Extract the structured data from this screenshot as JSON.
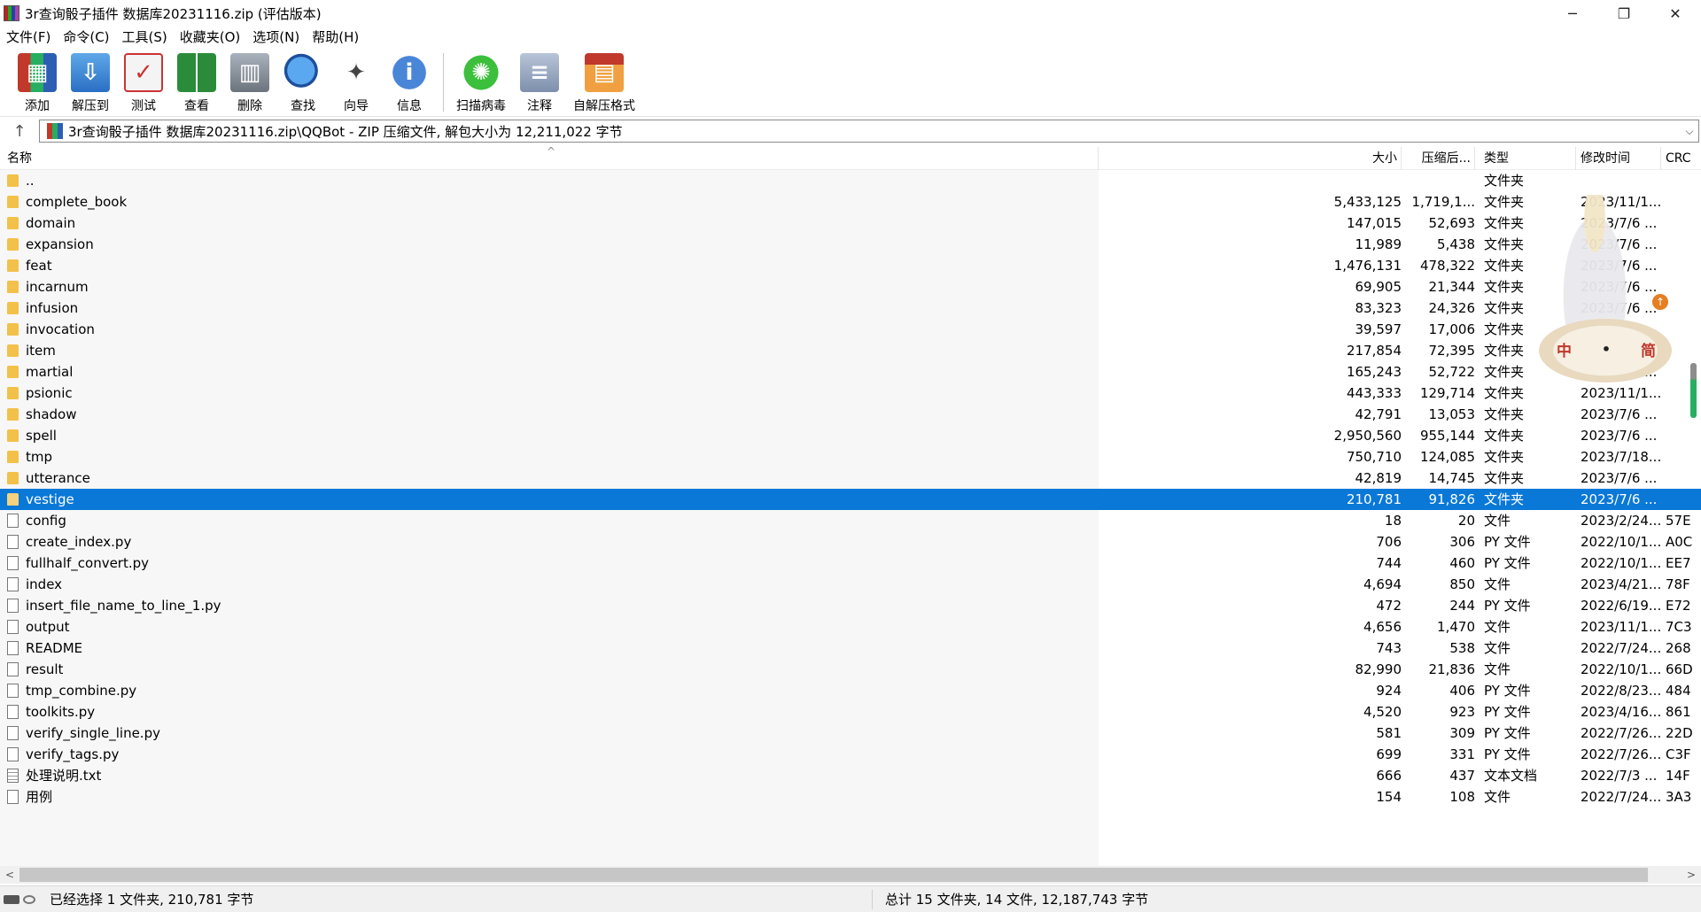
{
  "window": {
    "title": "3r查询骰子插件 数据库20231116.zip (评估版本)",
    "controls": {
      "minimize": "─",
      "maximize": "❐",
      "close": "✕"
    }
  },
  "menu": [
    "文件(F)",
    "命令(C)",
    "工具(S)",
    "收藏夹(O)",
    "选项(N)",
    "帮助(H)"
  ],
  "toolbar": [
    {
      "label": "添加",
      "icon": "add-archive-icon",
      "cls": "ic-add",
      "glyph": "▦"
    },
    {
      "label": "解压到",
      "icon": "extract-folder-icon",
      "cls": "ic-extract",
      "glyph": "⇩"
    },
    {
      "label": "测试",
      "icon": "test-clipboard-icon",
      "cls": "ic-test",
      "glyph": "✓"
    },
    {
      "label": "查看",
      "icon": "view-book-icon",
      "cls": "ic-view",
      "glyph": ""
    },
    {
      "label": "删除",
      "icon": "delete-trash-icon",
      "cls": "ic-delete",
      "glyph": "▥"
    },
    {
      "label": "查找",
      "icon": "find-magnifier-icon",
      "cls": "ic-find",
      "glyph": ""
    },
    {
      "label": "向导",
      "icon": "wizard-wand-icon",
      "cls": "ic-wizard",
      "glyph": "✦"
    },
    {
      "label": "信息",
      "icon": "info-icon",
      "cls": "ic-info",
      "glyph": "i"
    },
    {
      "separator": true
    },
    {
      "label": "扫描病毒",
      "icon": "scan-virus-icon",
      "cls": "ic-virus",
      "glyph": "✺"
    },
    {
      "label": "注释",
      "icon": "comment-icon",
      "cls": "ic-comment",
      "glyph": "≡"
    },
    {
      "label": "自解压格式",
      "icon": "sfx-box-icon",
      "cls": "ic-sfx",
      "glyph": "▤"
    }
  ],
  "address": {
    "up_icon": "↑",
    "path": "3r查询骰子插件 数据库20231116.zip\\QQBot - ZIP 压缩文件, 解包大小为 12,211,022 字节",
    "dropdown": "⌵"
  },
  "columns": {
    "name": "名称",
    "size": "大小",
    "packed": "压缩后...",
    "type": "类型",
    "modified": "修改时间",
    "crc": "CRC",
    "sort_arrow": "^"
  },
  "files": [
    {
      "name": "..",
      "size": "",
      "packed": "",
      "type": "文件夹",
      "modified": "",
      "crc": "",
      "kind": "folder"
    },
    {
      "name": "complete_book",
      "size": "5,433,125",
      "packed": "1,719,1...",
      "type": "文件夹",
      "modified": "2023/11/1...",
      "crc": "",
      "kind": "folder"
    },
    {
      "name": "domain",
      "size": "147,015",
      "packed": "52,693",
      "type": "文件夹",
      "modified": "2023/7/6 ...",
      "crc": "",
      "kind": "folder"
    },
    {
      "name": "expansion",
      "size": "11,989",
      "packed": "5,438",
      "type": "文件夹",
      "modified": "2023/7/6 ...",
      "crc": "",
      "kind": "folder"
    },
    {
      "name": "feat",
      "size": "1,476,131",
      "packed": "478,322",
      "type": "文件夹",
      "modified": "2023/7/6 ...",
      "crc": "",
      "kind": "folder"
    },
    {
      "name": "incarnum",
      "size": "69,905",
      "packed": "21,344",
      "type": "文件夹",
      "modified": "2023/7/6 ...",
      "crc": "",
      "kind": "folder"
    },
    {
      "name": "infusion",
      "size": "83,323",
      "packed": "24,326",
      "type": "文件夹",
      "modified": "2023/7/6 ...",
      "crc": "",
      "kind": "folder"
    },
    {
      "name": "invocation",
      "size": "39,597",
      "packed": "17,006",
      "type": "文件夹",
      "modified": "2023/7/6 ...",
      "crc": "",
      "kind": "folder"
    },
    {
      "name": "item",
      "size": "217,854",
      "packed": "72,395",
      "type": "文件夹",
      "modified": "2023/7/6 ...",
      "crc": "",
      "kind": "folder"
    },
    {
      "name": "martial",
      "size": "165,243",
      "packed": "52,722",
      "type": "文件夹",
      "modified": "2023/7/6 ...",
      "crc": "",
      "kind": "folder"
    },
    {
      "name": "psionic",
      "size": "443,333",
      "packed": "129,714",
      "type": "文件夹",
      "modified": "2023/11/1...",
      "crc": "",
      "kind": "folder"
    },
    {
      "name": "shadow",
      "size": "42,791",
      "packed": "13,053",
      "type": "文件夹",
      "modified": "2023/7/6 ...",
      "crc": "",
      "kind": "folder"
    },
    {
      "name": "spell",
      "size": "2,950,560",
      "packed": "955,144",
      "type": "文件夹",
      "modified": "2023/7/6 ...",
      "crc": "",
      "kind": "folder"
    },
    {
      "name": "tmp",
      "size": "750,710",
      "packed": "124,085",
      "type": "文件夹",
      "modified": "2023/7/18...",
      "crc": "",
      "kind": "folder"
    },
    {
      "name": "utterance",
      "size": "42,819",
      "packed": "14,745",
      "type": "文件夹",
      "modified": "2023/7/6 ...",
      "crc": "",
      "kind": "folder"
    },
    {
      "name": "vestige",
      "size": "210,781",
      "packed": "91,826",
      "type": "文件夹",
      "modified": "2023/7/6 ...",
      "crc": "",
      "kind": "folder",
      "selected": true
    },
    {
      "name": "config",
      "size": "18",
      "packed": "20",
      "type": "文件",
      "modified": "2023/2/24...",
      "crc": "57E",
      "kind": "file"
    },
    {
      "name": "create_index.py",
      "size": "706",
      "packed": "306",
      "type": "PY 文件",
      "modified": "2022/10/1...",
      "crc": "A0C",
      "kind": "file"
    },
    {
      "name": "fullhalf_convert.py",
      "size": "744",
      "packed": "460",
      "type": "PY 文件",
      "modified": "2022/10/1...",
      "crc": "EE7",
      "kind": "file"
    },
    {
      "name": "index",
      "size": "4,694",
      "packed": "850",
      "type": "文件",
      "modified": "2023/4/21...",
      "crc": "78F",
      "kind": "file"
    },
    {
      "name": "insert_file_name_to_line_1.py",
      "size": "472",
      "packed": "244",
      "type": "PY 文件",
      "modified": "2022/6/19...",
      "crc": "E72",
      "kind": "file"
    },
    {
      "name": "output",
      "size": "4,656",
      "packed": "1,470",
      "type": "文件",
      "modified": "2023/11/1...",
      "crc": "7C3",
      "kind": "file"
    },
    {
      "name": "README",
      "size": "743",
      "packed": "538",
      "type": "文件",
      "modified": "2022/7/24...",
      "crc": "268",
      "kind": "file"
    },
    {
      "name": "result",
      "size": "82,990",
      "packed": "21,836",
      "type": "文件",
      "modified": "2022/10/1...",
      "crc": "66D",
      "kind": "file"
    },
    {
      "name": "tmp_combine.py",
      "size": "924",
      "packed": "406",
      "type": "PY 文件",
      "modified": "2022/8/23...",
      "crc": "484",
      "kind": "file"
    },
    {
      "name": "toolkits.py",
      "size": "4,520",
      "packed": "923",
      "type": "PY 文件",
      "modified": "2023/4/16...",
      "crc": "861",
      "kind": "file"
    },
    {
      "name": "verify_single_line.py",
      "size": "581",
      "packed": "309",
      "type": "PY 文件",
      "modified": "2022/7/26...",
      "crc": "22D",
      "kind": "file"
    },
    {
      "name": "verify_tags.py",
      "size": "699",
      "packed": "331",
      "type": "PY 文件",
      "modified": "2022/7/26...",
      "crc": "C3F",
      "kind": "file"
    },
    {
      "name": "处理说明.txt",
      "size": "666",
      "packed": "437",
      "type": "文本文档",
      "modified": "2022/7/3 ...",
      "crc": "14F",
      "kind": "txt"
    },
    {
      "name": "用例",
      "size": "154",
      "packed": "108",
      "type": "文件",
      "modified": "2022/7/24...",
      "crc": "3A3",
      "kind": "file"
    }
  ],
  "ime_widget": {
    "left": "中",
    "dot": "•",
    "right": "简",
    "arrow": "↑"
  },
  "scroll": {
    "left_arrow": "<",
    "right_arrow": ">"
  },
  "status": {
    "selection": "已经选择 1 文件夹, 210,781 字节",
    "total": "总计 15 文件夹, 14 文件, 12,187,743 字节"
  }
}
